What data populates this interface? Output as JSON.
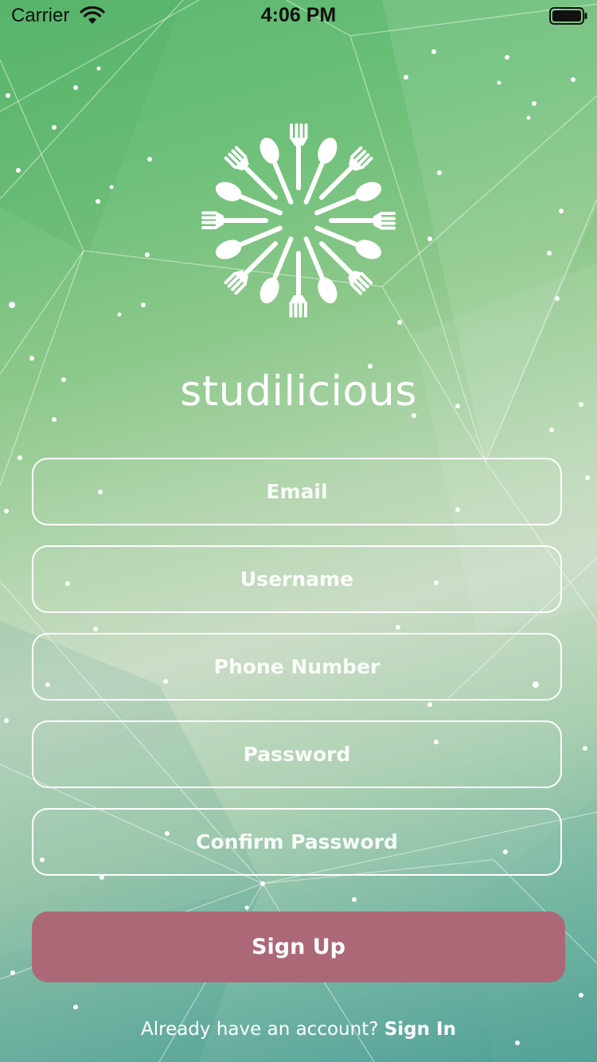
{
  "status_bar": {
    "carrier": "Carrier",
    "time": "4:06 PM"
  },
  "app": {
    "name": "studilicious",
    "logo_icon": "cutlery-burst-icon"
  },
  "form": {
    "email_placeholder": "Email",
    "username_placeholder": "Username",
    "phone_placeholder": "Phone Number",
    "password_placeholder": "Password",
    "confirm_password_placeholder": "Confirm Password",
    "signup_label": "Sign Up"
  },
  "footer": {
    "prompt": "Already have an account?",
    "signin_label": "Sign In"
  },
  "colors": {
    "accent_button": "#ac6877",
    "text": "#ffffff"
  }
}
